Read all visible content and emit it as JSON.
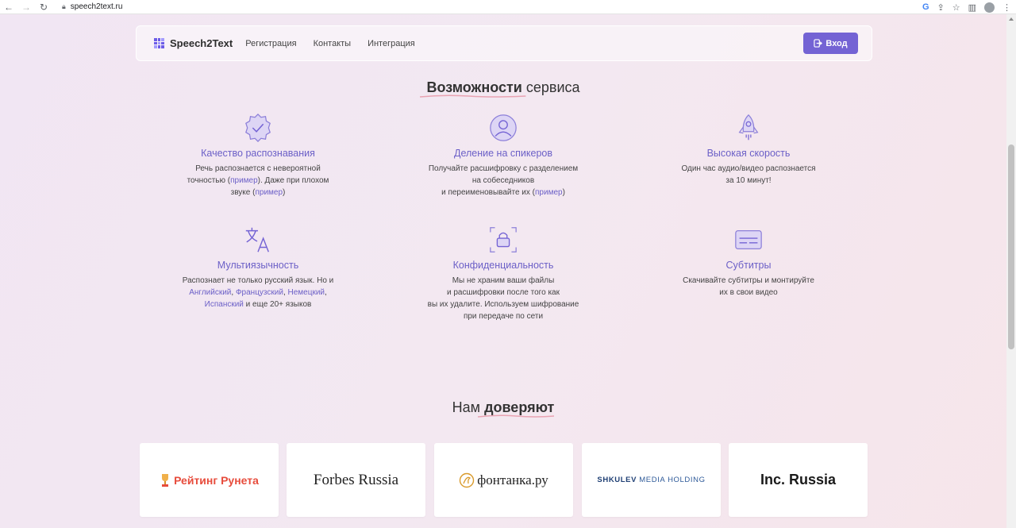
{
  "browser": {
    "url": "speech2text.ru"
  },
  "header": {
    "logo_text": "Speech2Text",
    "nav": [
      "Регистрация",
      "Контакты",
      "Интеграция"
    ],
    "login_label": "Вход"
  },
  "features_section": {
    "title_bold": "Возможности",
    "title_rest": " сервиса"
  },
  "features": [
    {
      "title": "Качество распознавания",
      "d1": "Речь распознается с невероятной",
      "d2a": "точностью (",
      "d2link": "пример",
      "d2b": "). Даже при плохом",
      "d3a": "звуке (",
      "d3link": "пример",
      "d3b": ")"
    },
    {
      "title": "Деление на спикеров",
      "d1": "Получайте расшифровку с разделением",
      "d2": "на собеседников",
      "d3a": "и переименовывайте их (",
      "d3link": "пример",
      "d3b": ")"
    },
    {
      "title": "Высокая скорость",
      "d1": "Один час аудио/видео распознается",
      "d2": "за 10 минут!"
    },
    {
      "title": "Мультиязычность",
      "d1": "Распознает не только русский язык. Но и",
      "l1": "Английский",
      "s1": ", ",
      "l2": "Французский",
      "s2": ", ",
      "l3": "Немецкий",
      "s3": ",",
      "l4": "Испанский",
      "d3b": " и еще 20+ языков"
    },
    {
      "title": "Конфиденциальность",
      "d1": "Мы не храним ваши файлы",
      "d2": "и расшифровки после того как",
      "d3": "вы их удалите. Используем шифрование",
      "d4": "при передаче по сети"
    },
    {
      "title": "Субтитры",
      "d1": "Скачивайте субтитры и монтируйте",
      "d2": "их в свои видео"
    }
  ],
  "trust_section": {
    "title_rest": "Нам ",
    "title_bold": "доверяют"
  },
  "trust_logos": [
    "Рейтинг Рунета",
    "Forbes Russia",
    "фонтанка.ру",
    "SHKULEV",
    " MEDIA HOLDING",
    "Inc. Russia"
  ],
  "colors": {
    "accent": "#7463d4",
    "link": "#6b5fc7"
  }
}
